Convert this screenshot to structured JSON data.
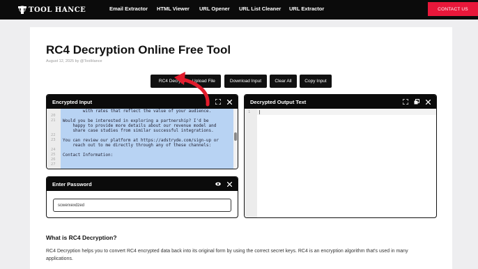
{
  "brand": {
    "name": "TOOL HANCE"
  },
  "nav": {
    "links": [
      "Email Extractor",
      "HTML Viewer",
      "URL Opener",
      "URL List Cleaner",
      "URL Extractor"
    ],
    "contact_label": "CONTACT US"
  },
  "page": {
    "title": "RC4 Decryption Online Free Tool",
    "meta": "August 12, 2025 by @ToolHance"
  },
  "actions": [
    "RC4 Decrypt",
    "Upload File",
    "Download Input",
    "Clear All",
    "Copy Input"
  ],
  "encrypted_panel": {
    "title": "Encrypted Input",
    "lines": [
      {
        "num": "",
        "text": "        with rates that reflect the value of your audience."
      },
      {
        "num": "20",
        "text": ""
      },
      {
        "num": "21",
        "text": "Would you be interested in exploring a partnership? I'd be"
      },
      {
        "num": "",
        "text": "    happy to provide more details about our revenue model and"
      },
      {
        "num": "",
        "text": "    share case studies from similar successful integrations."
      },
      {
        "num": "22",
        "text": ""
      },
      {
        "num": "23",
        "text": "You can review our platform at https://adstryde.com/sign-up or"
      },
      {
        "num": "",
        "text": "    reach out to me directly through any of these channels:"
      },
      {
        "num": "24",
        "text": ""
      },
      {
        "num": "25",
        "text": "Contact Information:"
      },
      {
        "num": "26",
        "text": ""
      },
      {
        "num": "27",
        "text": ""
      }
    ]
  },
  "password_panel": {
    "title": "Enter Password",
    "value": "scwerxexdzed"
  },
  "output_panel": {
    "title": "Decrypted Output Text",
    "line_number": "1"
  },
  "section": {
    "title": "What is RC4 Decryption?",
    "text": "RC4 Decryption helps you to convert RC4 encrypted data back into its original form by using the correct secret keys. RC4 is an encryption algorithm that's used in many applications."
  },
  "icons": {
    "fullscreen": "fullscreen-icon",
    "close": "close-icon",
    "eye": "eye-icon",
    "copy": "copy-icon"
  },
  "colors": {
    "accent": "#e8173a",
    "nav_bg": "#0b0b0b",
    "selection": "#b8d3f3"
  }
}
